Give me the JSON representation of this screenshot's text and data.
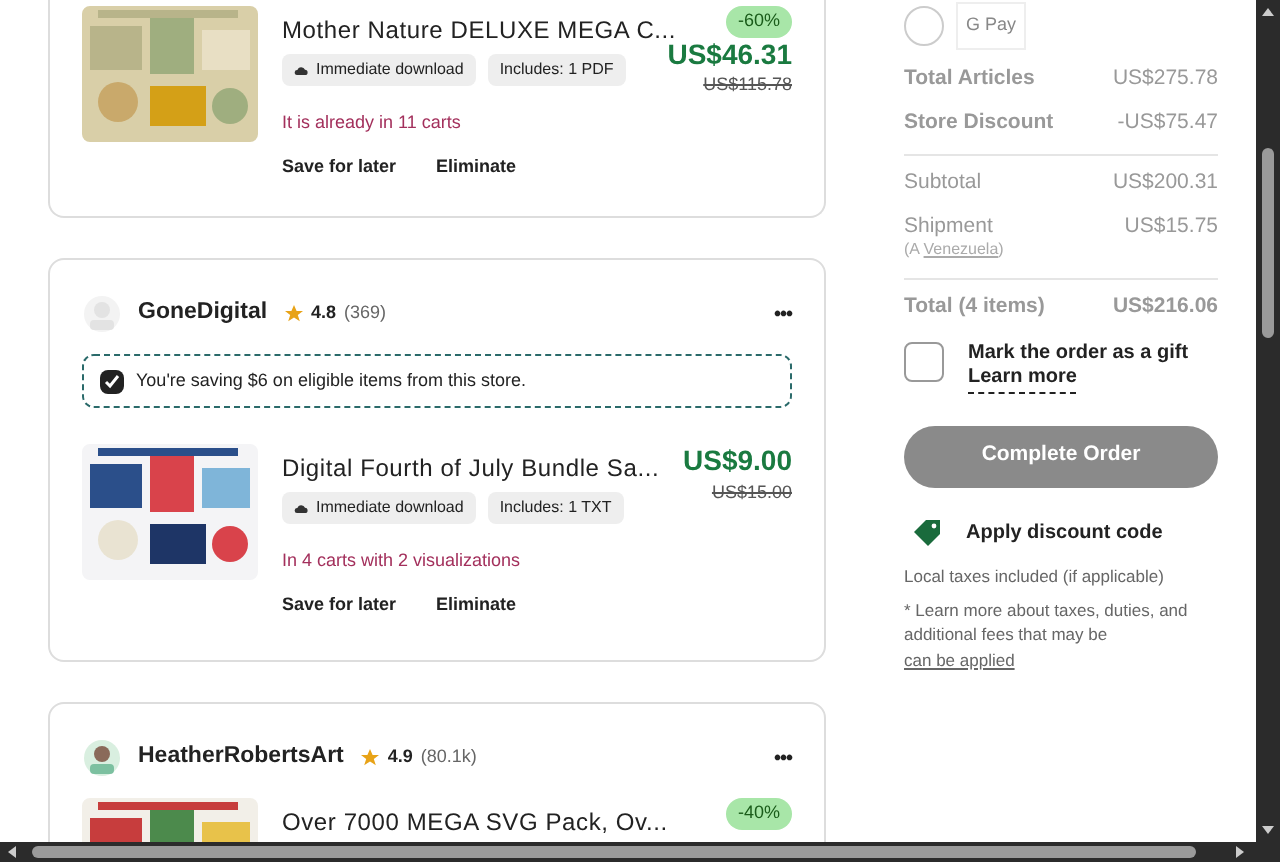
{
  "stores": [
    {
      "items": [
        {
          "title": "Mother Nature DELUXE MEGA C...",
          "badges": [
            "Immediate download",
            "Includes: 1 PDF"
          ],
          "discount": "-60%",
          "price": "US$46.31",
          "original_price": "US$115.78",
          "cart_note": "It is already in 11 carts",
          "actions": [
            "Save for later",
            "Eliminate"
          ]
        }
      ]
    },
    {
      "shop": {
        "name": "GoneDigital",
        "rating": "4.8",
        "reviews": "(369)",
        "menu": "•••"
      },
      "savings": {
        "text": "You're saving $6 on eligible items from this store.",
        "checked": true
      },
      "items": [
        {
          "title": "Digital Fourth of July Bundle Sa...",
          "badges": [
            "Immediate download",
            "Includes: 1 TXT"
          ],
          "price": "US$9.00",
          "original_price": "US$15.00",
          "cart_note": "In 4 carts with 2 visualizations",
          "actions": [
            "Save for later",
            "Eliminate"
          ]
        }
      ]
    },
    {
      "shop": {
        "name": "HeatherRobertsArt",
        "rating": "4.9",
        "reviews": "(80.1k)",
        "menu": "•••"
      },
      "items": [
        {
          "title": "Over 7000 MEGA SVG Pack, Ov...",
          "discount": "-40%"
        }
      ]
    }
  ],
  "payment": {
    "label": "G Pay",
    "selected": false
  },
  "summary": [
    {
      "label": "Total Articles",
      "value": "US$275.78",
      "kind": "bold",
      "divider": false
    },
    {
      "label": "Store Discount",
      "value": "-US$75.47",
      "kind": "bold",
      "divider": false
    },
    {
      "label": "Subtotal",
      "value": "US$200.31",
      "kind": "plain",
      "divider": true
    },
    {
      "label": "Shipment",
      "value": "US$15.75",
      "kind": "plain",
      "divider": false,
      "note_prefix": "(A ",
      "note_link": "Venezuela",
      "note_suffix": ")"
    },
    {
      "label": "Total (4 items)",
      "value": "US$216.06",
      "kind": "bold",
      "divider": true
    }
  ],
  "gift": {
    "label": "Mark the order as a gift",
    "link": "Learn more",
    "checked": false
  },
  "complete_button": {
    "label": "Complete Order",
    "disabled": true
  },
  "discount_code": "Apply discount code",
  "taxes_note": "Local taxes included (if applicable)",
  "fees_note": "* Learn more about taxes, duties, and additional fees that may be",
  "fees_link": "can be applied"
}
